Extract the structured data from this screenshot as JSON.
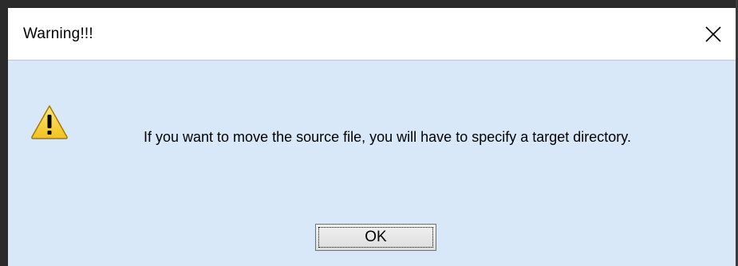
{
  "dialog": {
    "title": "Warning!!!",
    "message": "If you want to move the source file, you will have to specify a target directory.",
    "ok_label": "OK",
    "icon": "warning-icon",
    "close_icon": "close-icon"
  },
  "colors": {
    "content_background": "#d9e8f8",
    "warning_yellow": "#f7d54a",
    "frame": "#2b2b2b"
  }
}
